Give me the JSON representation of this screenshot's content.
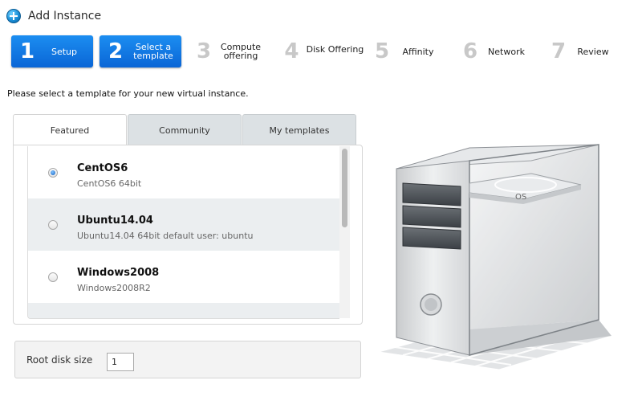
{
  "header": {
    "title": "Add Instance",
    "icon": "add-icon"
  },
  "steps": [
    {
      "num": "1",
      "label": "Setup",
      "active": true
    },
    {
      "num": "2",
      "label": "Select a template",
      "active": true
    },
    {
      "num": "3",
      "label": "Compute offering",
      "active": false
    },
    {
      "num": "4",
      "label": "Disk Offering",
      "active": false
    },
    {
      "num": "5",
      "label": "Affinity",
      "active": false
    },
    {
      "num": "6",
      "label": "Network",
      "active": false
    },
    {
      "num": "7",
      "label": "Review",
      "active": false
    }
  ],
  "instruction": "Please select a template for your new virtual instance.",
  "tabs": [
    {
      "label": "Featured",
      "active": true
    },
    {
      "label": "Community",
      "active": false
    },
    {
      "label": "My templates",
      "active": false
    }
  ],
  "templates": [
    {
      "name": "CentOS6",
      "desc": "CentOS6  64bit",
      "selected": true
    },
    {
      "name": "Ubuntu14.04",
      "desc": "Ubuntu14.04  64bit default user: ubuntu",
      "selected": false
    },
    {
      "name": "Windows2008",
      "desc": "Windows2008R2",
      "selected": false
    }
  ],
  "root_disk": {
    "label": "Root disk size",
    "value": "1"
  },
  "server_label": "OS",
  "colors": {
    "accent": "#0a66d6",
    "row_alt": "#ebeef0"
  }
}
